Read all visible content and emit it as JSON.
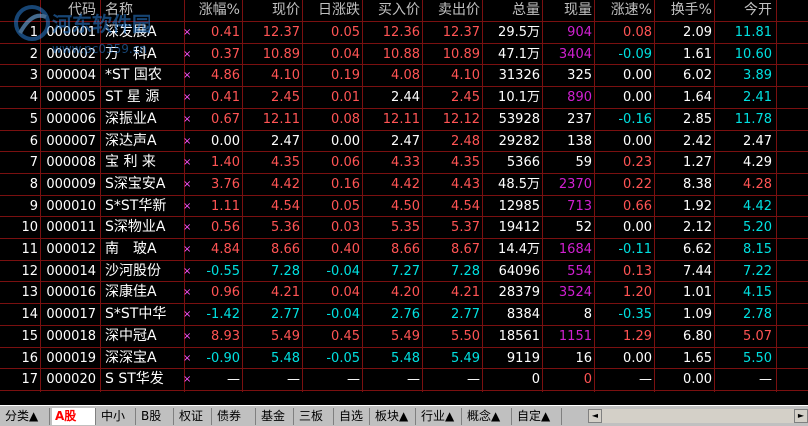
{
  "watermark": {
    "text": "河东软件园",
    "url": "www.pc0359.cn"
  },
  "header": [
    "",
    "代码",
    "名称",
    "涨幅%",
    "现价",
    "日涨跌",
    "买入价",
    "卖出价",
    "总量",
    "现量",
    "涨速%",
    "换手%",
    "今开"
  ],
  "rows": [
    {
      "no": "1",
      "code": "000001",
      "name": "深发展A",
      "chg": "0.41",
      "price": "12.37",
      "diff": "0.05",
      "bid": "12.36",
      "ask": "12.37",
      "vol": "29.5万",
      "cur": "904",
      "spd": "0.08",
      "turn": "2.09",
      "open": "11.81",
      "c": {
        "chg": "red",
        "price": "red",
        "diff": "red",
        "bid": "red",
        "ask": "red",
        "cur": "mag",
        "spd": "red",
        "open": "grn"
      }
    },
    {
      "no": "2",
      "code": "000002",
      "name": "万　科A",
      "chg": "0.37",
      "price": "10.89",
      "diff": "0.04",
      "bid": "10.88",
      "ask": "10.89",
      "vol": "47.1万",
      "cur": "3404",
      "spd": "-0.09",
      "turn": "1.61",
      "open": "10.60",
      "c": {
        "chg": "red",
        "price": "red",
        "diff": "red",
        "bid": "red",
        "ask": "red",
        "cur": "mag",
        "spd": "grn",
        "open": "grn"
      }
    },
    {
      "no": "3",
      "code": "000004",
      "name": "*ST 国农",
      "chg": "4.86",
      "price": "4.10",
      "diff": "0.19",
      "bid": "4.08",
      "ask": "4.10",
      "vol": "31326",
      "cur": "325",
      "spd": "0.00",
      "turn": "6.02",
      "open": "3.89",
      "c": {
        "chg": "red",
        "price": "red",
        "diff": "red",
        "bid": "red",
        "ask": "red",
        "cur": "w",
        "spd": "w",
        "open": "grn"
      }
    },
    {
      "no": "4",
      "code": "000005",
      "name": "ST 星 源",
      "chg": "0.41",
      "price": "2.45",
      "diff": "0.01",
      "bid": "2.44",
      "ask": "2.45",
      "vol": "10.1万",
      "cur": "890",
      "spd": "0.00",
      "turn": "1.64",
      "open": "2.41",
      "c": {
        "chg": "red",
        "price": "red",
        "diff": "red",
        "bid": "w",
        "ask": "red",
        "cur": "mag",
        "spd": "w",
        "open": "grn"
      }
    },
    {
      "no": "5",
      "code": "000006",
      "name": "深振业A",
      "chg": "0.67",
      "price": "12.11",
      "diff": "0.08",
      "bid": "12.11",
      "ask": "12.12",
      "vol": "53928",
      "cur": "237",
      "spd": "-0.16",
      "turn": "2.85",
      "open": "11.78",
      "c": {
        "chg": "red",
        "price": "red",
        "diff": "red",
        "bid": "red",
        "ask": "red",
        "cur": "w",
        "spd": "grn",
        "open": "grn"
      }
    },
    {
      "no": "6",
      "code": "000007",
      "name": "深达声A",
      "chg": "0.00",
      "price": "2.47",
      "diff": "0.00",
      "bid": "2.47",
      "ask": "2.48",
      "vol": "29282",
      "cur": "138",
      "spd": "0.00",
      "turn": "2.42",
      "open": "2.47",
      "c": {
        "chg": "w",
        "price": "w",
        "diff": "w",
        "bid": "w",
        "ask": "red",
        "cur": "w",
        "spd": "w",
        "open": "w"
      }
    },
    {
      "no": "7",
      "code": "000008",
      "name": "宝 利 来",
      "chg": "1.40",
      "price": "4.35",
      "diff": "0.06",
      "bid": "4.33",
      "ask": "4.35",
      "vol": "5366",
      "cur": "59",
      "spd": "0.23",
      "turn": "1.27",
      "open": "4.29",
      "c": {
        "chg": "red",
        "price": "red",
        "diff": "red",
        "bid": "red",
        "ask": "red",
        "cur": "w",
        "spd": "red",
        "open": "w"
      }
    },
    {
      "no": "8",
      "code": "000009",
      "name": "S深宝安A",
      "chg": "3.76",
      "price": "4.42",
      "diff": "0.16",
      "bid": "4.42",
      "ask": "4.43",
      "vol": "48.5万",
      "cur": "2370",
      "spd": "0.22",
      "turn": "8.38",
      "open": "4.28",
      "c": {
        "chg": "red",
        "price": "red",
        "diff": "red",
        "bid": "red",
        "ask": "red",
        "cur": "mag",
        "spd": "red",
        "open": "red"
      }
    },
    {
      "no": "9",
      "code": "000010",
      "name": "S*ST华新",
      "chg": "1.11",
      "price": "4.54",
      "diff": "0.05",
      "bid": "4.50",
      "ask": "4.54",
      "vol": "12985",
      "cur": "713",
      "spd": "0.66",
      "turn": "1.92",
      "open": "4.42",
      "c": {
        "chg": "red",
        "price": "red",
        "diff": "red",
        "bid": "red",
        "ask": "red",
        "cur": "mag",
        "spd": "red",
        "open": "grn"
      }
    },
    {
      "no": "10",
      "code": "000011",
      "name": "S深物业A",
      "chg": "0.56",
      "price": "5.36",
      "diff": "0.03",
      "bid": "5.35",
      "ask": "5.37",
      "vol": "19412",
      "cur": "52",
      "spd": "0.00",
      "turn": "2.12",
      "open": "5.20",
      "c": {
        "chg": "red",
        "price": "red",
        "diff": "red",
        "bid": "red",
        "ask": "red",
        "cur": "w",
        "spd": "w",
        "open": "grn"
      }
    },
    {
      "no": "11",
      "code": "000012",
      "name": "南　玻A",
      "chg": "4.84",
      "price": "8.66",
      "diff": "0.40",
      "bid": "8.66",
      "ask": "8.67",
      "vol": "14.4万",
      "cur": "1684",
      "spd": "-0.11",
      "turn": "6.62",
      "open": "8.15",
      "c": {
        "chg": "red",
        "price": "red",
        "diff": "red",
        "bid": "red",
        "ask": "red",
        "cur": "mag",
        "spd": "grn",
        "open": "grn"
      }
    },
    {
      "no": "12",
      "code": "000014",
      "name": "沙河股份",
      "chg": "-0.55",
      "price": "7.28",
      "diff": "-0.04",
      "bid": "7.27",
      "ask": "7.28",
      "vol": "64096",
      "cur": "554",
      "spd": "0.13",
      "turn": "7.44",
      "open": "7.22",
      "c": {
        "chg": "grn",
        "price": "grn",
        "diff": "grn",
        "bid": "grn",
        "ask": "grn",
        "cur": "mag",
        "spd": "red",
        "open": "grn"
      }
    },
    {
      "no": "13",
      "code": "000016",
      "name": "深康佳A",
      "chg": "0.96",
      "price": "4.21",
      "diff": "0.04",
      "bid": "4.20",
      "ask": "4.21",
      "vol": "28379",
      "cur": "3524",
      "spd": "1.20",
      "turn": "1.01",
      "open": "4.15",
      "c": {
        "chg": "red",
        "price": "red",
        "diff": "red",
        "bid": "red",
        "ask": "red",
        "cur": "mag",
        "spd": "red",
        "open": "grn"
      }
    },
    {
      "no": "14",
      "code": "000017",
      "name": "S*ST中华",
      "chg": "-1.42",
      "price": "2.77",
      "diff": "-0.04",
      "bid": "2.76",
      "ask": "2.77",
      "vol": "8384",
      "cur": "8",
      "spd": "-0.35",
      "turn": "1.09",
      "open": "2.78",
      "c": {
        "chg": "grn",
        "price": "grn",
        "diff": "grn",
        "bid": "grn",
        "ask": "grn",
        "cur": "w",
        "spd": "grn",
        "open": "grn"
      }
    },
    {
      "no": "15",
      "code": "000018",
      "name": "深中冠A",
      "chg": "8.93",
      "price": "5.49",
      "diff": "0.45",
      "bid": "5.49",
      "ask": "5.50",
      "vol": "18561",
      "cur": "1151",
      "spd": "1.29",
      "turn": "6.80",
      "open": "5.07",
      "c": {
        "chg": "red",
        "price": "red",
        "diff": "red",
        "bid": "red",
        "ask": "red",
        "cur": "mag",
        "spd": "red",
        "open": "red"
      }
    },
    {
      "no": "16",
      "code": "000019",
      "name": "深深宝A",
      "chg": "-0.90",
      "price": "5.48",
      "diff": "-0.05",
      "bid": "5.48",
      "ask": "5.49",
      "vol": "9119",
      "cur": "16",
      "spd": "0.00",
      "turn": "1.65",
      "open": "5.50",
      "c": {
        "chg": "grn",
        "price": "grn",
        "diff": "grn",
        "bid": "grn",
        "ask": "grn",
        "cur": "w",
        "spd": "w",
        "open": "grn"
      }
    },
    {
      "no": "17",
      "code": "000020",
      "name": "S ST华发",
      "chg": "—",
      "price": "—",
      "diff": "—",
      "bid": "—",
      "ask": "—",
      "vol": "0",
      "cur": "0",
      "spd": "—",
      "turn": "0.00",
      "open": "—",
      "c": {
        "chg": "w",
        "price": "w",
        "diff": "w",
        "bid": "w",
        "ask": "w",
        "cur": "red",
        "spd": "w",
        "open": "w"
      }
    }
  ],
  "mark": "×",
  "tabs": [
    "分类▲",
    "A股",
    "中小",
    "B股",
    "权证",
    "债券",
    "基金",
    "三板",
    "自选",
    "板块▲",
    "行业▲",
    "概念▲",
    "自定▲"
  ],
  "active_tab": "A股",
  "scroll": {
    "left": "◄",
    "right": "►"
  },
  "colors": {
    "red": "#ff5454",
    "green": "#00e0e0",
    "magenta": "#d020d0",
    "grid": "#7a1010"
  }
}
